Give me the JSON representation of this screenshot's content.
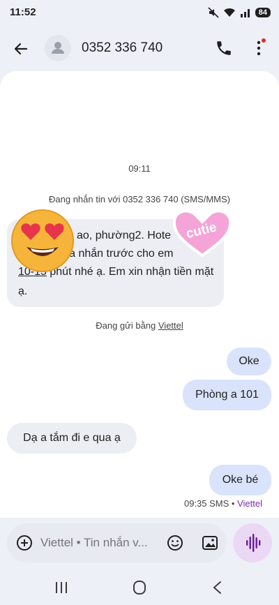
{
  "status_bar": {
    "time": "11:52",
    "battery": "84"
  },
  "header": {
    "contact_number": "0352 336 740"
  },
  "chat": {
    "timestamp": "09:11",
    "conversation_info": "Đang nhắn tin với 0352 336 740 (SMS/MMS)",
    "incoming_first": {
      "line1": "ao, phường2. Hote",
      "line2": "n qua nhắn trước cho em",
      "line3_link": "10-15",
      "line3_rest": " phút nhé ạ. Em xin nhận tiền mặt",
      "line4": "ạ."
    },
    "sending_via_prefix": "Đang gửi bằng ",
    "sending_via_carrier": "Viettel",
    "outgoing_1": "Oke",
    "outgoing_2": "Phòng a 101",
    "incoming_2": "Dạ a tắm đi e qua ạ",
    "outgoing_3": "Oke bé",
    "last_meta_time": "09:35 SMS",
    "last_meta_carrier": "Viettel"
  },
  "composer": {
    "input_placeholder": "Viettel • Tin nhắn v..."
  },
  "stickers": {
    "cutie_text": "cutie"
  },
  "colors": {
    "accent": "#7a2aa5",
    "outgoing_bubble": "#d9e3fb",
    "incoming_bubble": "#eceef3"
  }
}
